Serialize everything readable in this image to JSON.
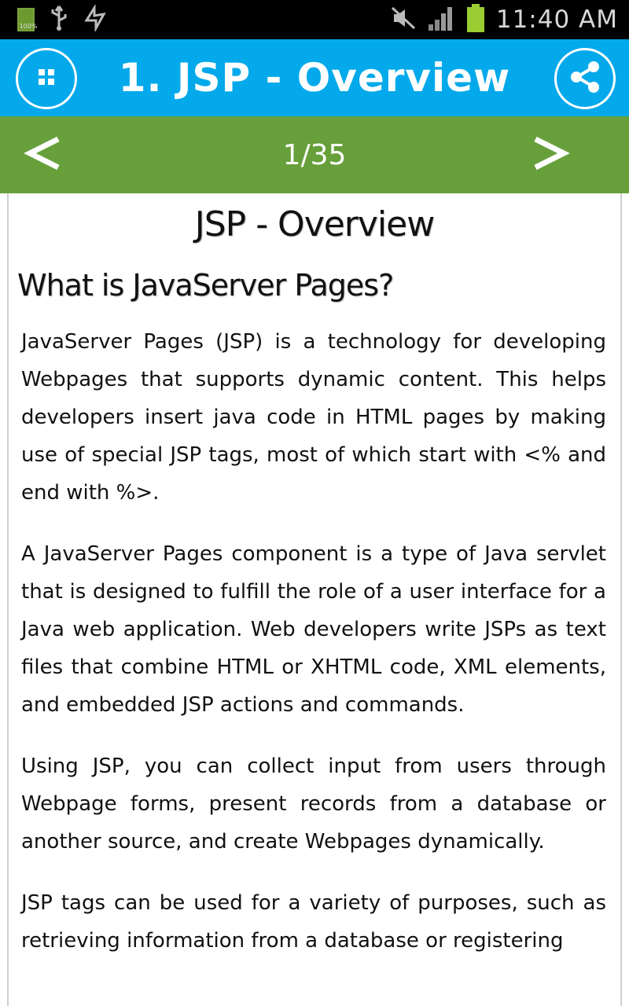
{
  "status_bar": {
    "time": "11:40 AM",
    "battery_small_label": "100%",
    "icons": [
      "battery-icon",
      "usb-icon",
      "sync-icon",
      "mute-icon",
      "signal-icon",
      "battery-full-icon"
    ]
  },
  "header": {
    "title": "1. JSP - Overview",
    "menu_icon": "grid-icon",
    "share_icon": "share-icon",
    "color": "#03a9ea"
  },
  "pager": {
    "prev_label": "<",
    "next_label": ">",
    "page_indicator": "1/35",
    "color": "#67a03b"
  },
  "article": {
    "title": "JSP - Overview",
    "section_heading": "What is JavaServer Pages?",
    "paragraphs": [
      "JavaServer Pages (JSP) is a technology for developing Webpages that supports dynamic content. This helps developers insert java code in HTML pages by making use of special JSP tags, most of which start with <% and end with %>.",
      "A JavaServer Pages component is a type of Java servlet that is designed to fulfill the role of a user interface for a Java web application. Web developers write JSPs as text files that combine HTML or XHTML code, XML elements, and embedded JSP actions and commands.",
      "Using JSP, you can collect input from users through Webpage forms, present records from a database or another source, and create Webpages dynamically.",
      "JSP tags can be used for a variety of purposes, such as retrieving information from a database or registering"
    ]
  }
}
